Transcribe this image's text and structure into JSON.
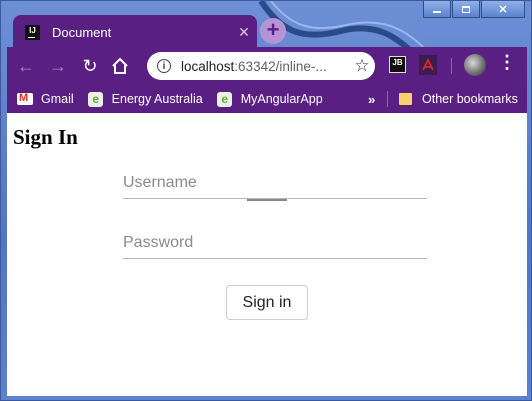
{
  "window": {
    "controls": [
      "minimize",
      "maximize",
      "close"
    ]
  },
  "tabs": [
    {
      "title": "Document",
      "favicon": "intellij-icon",
      "active": true
    }
  ],
  "toolbar": {
    "url_host": "localhost",
    "url_rest": ":63342/inline-...",
    "extensions": [
      "jetbrains-icon",
      "adobe-pdf-icon"
    ]
  },
  "bookmarks": {
    "items": [
      {
        "label": "Gmail",
        "icon": "gmail-icon"
      },
      {
        "label": "Energy Australia",
        "icon": "energy-australia-icon"
      },
      {
        "label": "MyAngularApp",
        "icon": "energy-australia-icon"
      }
    ],
    "overflow": "»",
    "other": "Other bookmarks"
  },
  "page": {
    "title": "Sign In",
    "username_placeholder": "Username",
    "password_placeholder": "Password",
    "signin_label": "Sign in"
  },
  "colors": {
    "chrome_purple": "#5a1f82",
    "frame_blue": "#5b81c9",
    "newtab_lilac": "#b692d6"
  }
}
